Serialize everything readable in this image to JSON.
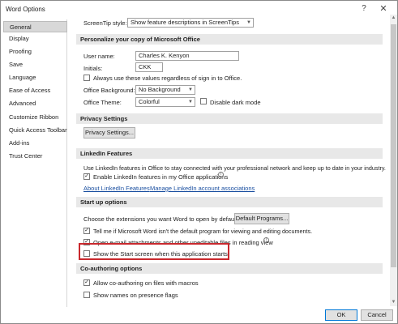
{
  "window": {
    "title": "Word Options",
    "help_glyph": "?",
    "close_glyph": "✕"
  },
  "sidebar": {
    "items": [
      {
        "label": "General",
        "selected": true
      },
      {
        "label": "Display"
      },
      {
        "label": "Proofing"
      },
      {
        "label": "Save"
      },
      {
        "label": "Language"
      },
      {
        "label": "Ease of Access"
      },
      {
        "label": "Advanced"
      },
      {
        "label": "Customize Ribbon"
      },
      {
        "label": "Quick Access Toolbar"
      },
      {
        "label": "Add-ins"
      },
      {
        "label": "Trust Center"
      }
    ]
  },
  "ui_options": {
    "screentip_label": "ScreenTip style:",
    "screentip_value": "Show feature descriptions in ScreenTips"
  },
  "personalize": {
    "header": "Personalize your copy of Microsoft Office",
    "username_label": "User name:",
    "username_value": "Charles K. Kenyon",
    "initials_label": "Initials:",
    "initials_value": "CKK",
    "always_use_label": "Always use these values regardless of sign in to Office.",
    "always_use_checked": false,
    "background_label": "Office Background:",
    "background_value": "No Background",
    "theme_label": "Office Theme:",
    "theme_value": "Colorful",
    "disable_dark_label": "Disable dark mode",
    "disable_dark_checked": false
  },
  "privacy": {
    "header": "Privacy Settings",
    "button_label": "Privacy Settings..."
  },
  "linkedin": {
    "header": "LinkedIn Features",
    "description": "Use LinkedIn features in Office to stay connected with your professional network and keep up to date in your industry.",
    "enable_label": "Enable LinkedIn features in my Office applications",
    "enable_checked": true,
    "about_link": "About LinkedIn Features",
    "manage_link": "Manage LinkedIn account associations"
  },
  "startup": {
    "header": "Start up options",
    "choose_label": "Choose the extensions you want Word to open by default:",
    "default_programs_button": "Default Programs...",
    "tell_me_label": "Tell me if Microsoft Word isn't the default program for viewing and editing documents.",
    "tell_me_checked": true,
    "open_attachments_label": "Open e-mail attachments and other uneditable files in reading view",
    "open_attachments_checked": true,
    "show_start_label": "Show the Start screen when this application starts",
    "show_start_checked": false
  },
  "coauthoring": {
    "header": "Co-authoring options",
    "allow_label": "Allow co-authoring on files with macros",
    "allow_checked": true,
    "show_names_label": "Show names on presence flags",
    "show_names_checked": false
  },
  "footer": {
    "ok_label": "OK",
    "cancel_label": "Cancel"
  },
  "glyphs": {
    "check": "✓",
    "info": "i",
    "dropdown": "▼",
    "scroll_up": "▲",
    "scroll_down": "▼"
  }
}
